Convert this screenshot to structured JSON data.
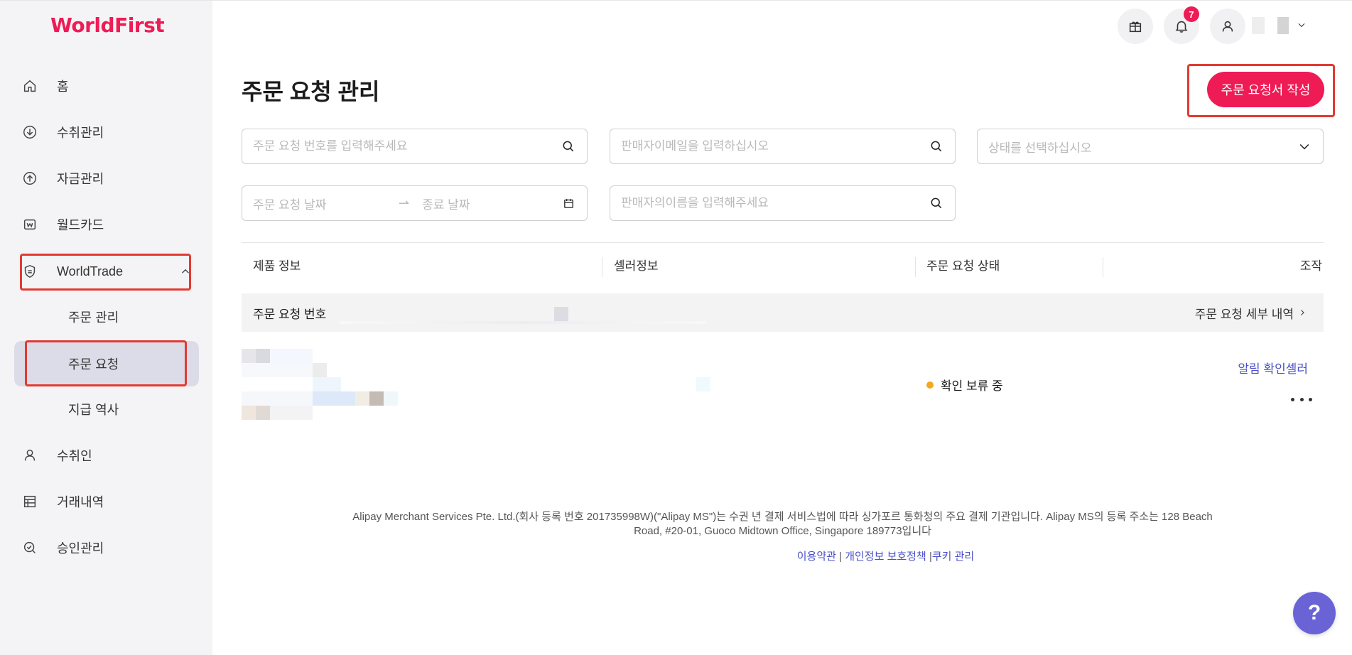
{
  "brand": {
    "logo_text": "WorldFirst",
    "accent_color": "#ee1b55"
  },
  "sidebar": {
    "items": [
      {
        "label": "홈",
        "icon": "home-icon"
      },
      {
        "label": "수취관리",
        "icon": "receive-icon"
      },
      {
        "label": "자금관리",
        "icon": "funds-icon"
      },
      {
        "label": "월드카드",
        "icon": "card-icon"
      },
      {
        "label": "WorldTrade",
        "icon": "shield-icon"
      },
      {
        "label": "수취인",
        "icon": "payee-icon"
      },
      {
        "label": "거래내역",
        "icon": "transactions-icon"
      },
      {
        "label": "승인관리",
        "icon": "approval-icon"
      }
    ],
    "sub_items": [
      {
        "label": "주문 관리"
      },
      {
        "label": "주문 요청"
      },
      {
        "label": "지급 역사"
      }
    ]
  },
  "header": {
    "notification_count": "7"
  },
  "main": {
    "title": "주문 요청 관리",
    "create_button": "주문 요청서 작성",
    "filters": {
      "order_no_placeholder": "주문 요청 번호를 입력해주세요",
      "seller_email_placeholder": "판매자이메일을 입력하십시오",
      "status_placeholder": "상태를 선택하십시오",
      "start_date_placeholder": "주문 요청 날짜",
      "end_date_placeholder": "종료 날짜",
      "seller_name_placeholder": "판매자의이름을 입력해주세요"
    },
    "table": {
      "headers": [
        "제품 정보",
        "셀러정보",
        "주문 요청 상태",
        "조작"
      ],
      "group_label": "주문 요청 번호",
      "group_detail_link": "주문 요청 세부 내역",
      "row": {
        "status": "확인 보류 중",
        "status_color": "#f5a623",
        "action_link": "알림 확인셀러"
      }
    }
  },
  "footer": {
    "text": "Alipay Merchant Services Pte. Ltd.(회사 등록 번호 201735998W)(\"Alipay MS\")는 수권 년 결제 서비스법에 따라 싱가포르 통화청의 주요 결제 기관입니다. Alipay MS의 등록 주소는 128 Beach Road, #20-01, Guoco Midtown Office, Singapore 189773입니다",
    "links": [
      "이용약관",
      "개인정보 보호정책",
      "쿠키 관리"
    ],
    "separator": "|"
  },
  "help_button": "?"
}
